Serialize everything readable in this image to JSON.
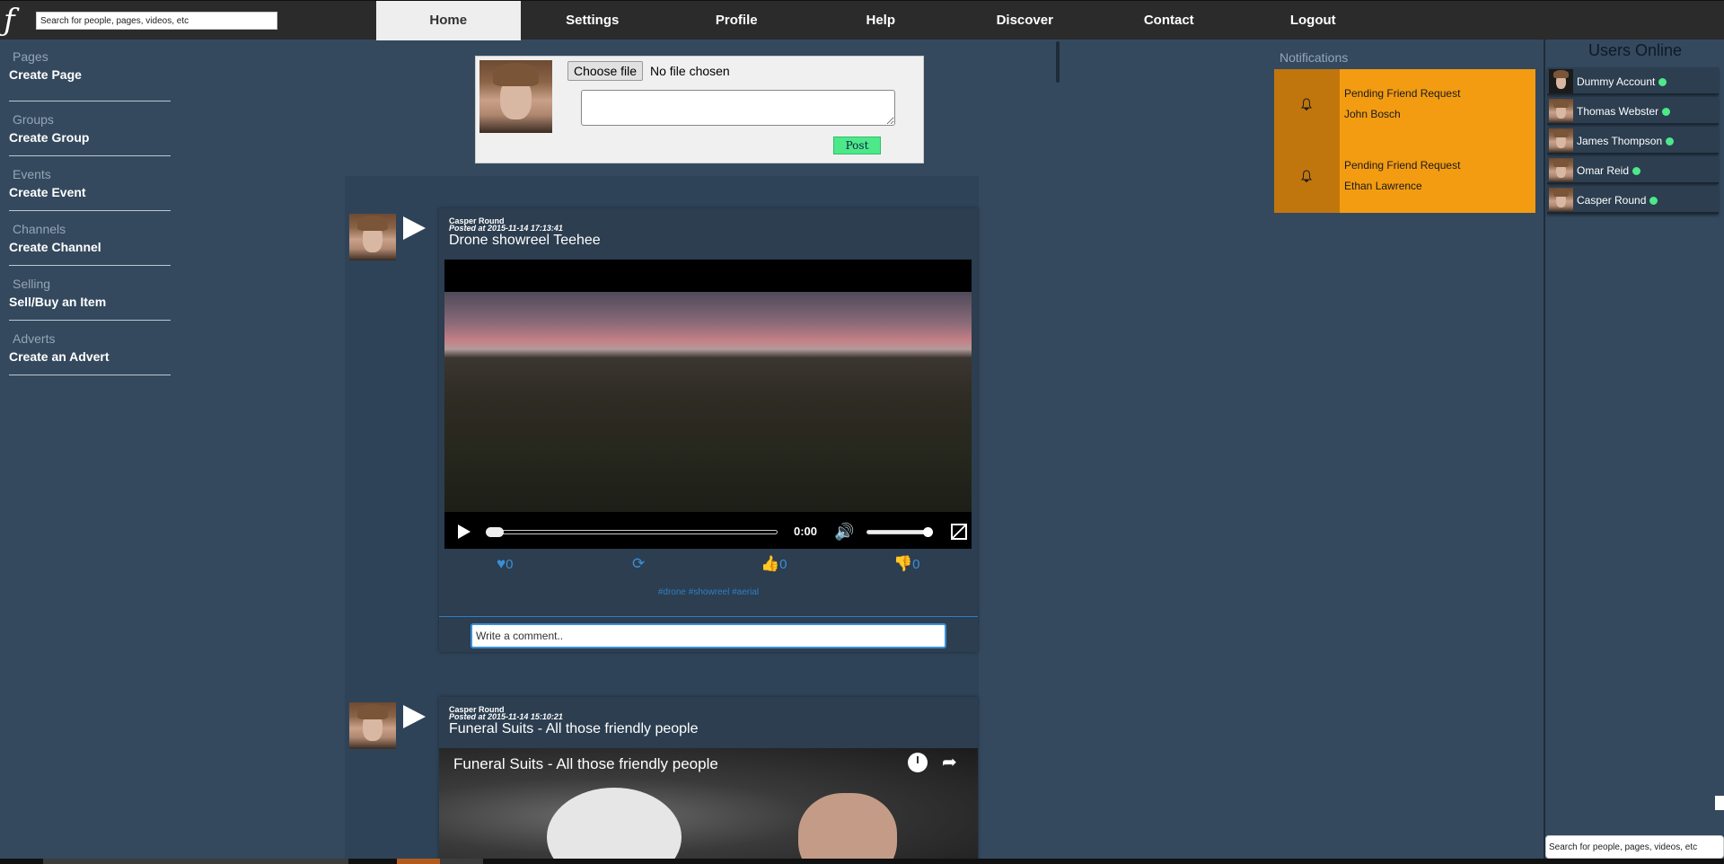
{
  "topbar": {
    "logo": "ƒ",
    "search_placeholder": "Search for people, pages, videos, etc",
    "nav": [
      {
        "label": "Home",
        "active": true
      },
      {
        "label": "Settings"
      },
      {
        "label": "Profile"
      },
      {
        "label": "Help"
      },
      {
        "label": "Discover"
      },
      {
        "label": "Contact"
      },
      {
        "label": "Logout"
      }
    ]
  },
  "sidebar": {
    "groups": [
      {
        "category": "Pages",
        "link": "Create Page"
      },
      {
        "category": "Groups",
        "link": "Create Group"
      },
      {
        "category": "Events",
        "link": "Create Event"
      },
      {
        "category": "Channels",
        "link": "Create Channel"
      },
      {
        "category": "Selling",
        "link": "Sell/Buy an Item"
      },
      {
        "category": "Adverts",
        "link": "Create an Advert"
      }
    ]
  },
  "composer": {
    "choose_file_label": "Choose file",
    "no_file_text": "No file chosen",
    "post_label": "Post"
  },
  "posts": [
    {
      "author": "Casper Round",
      "posted": "Posted at 2015-11-14 17:13:41",
      "title": "Drone showreel Teehee",
      "video_time": "0:00",
      "likes": "0",
      "shares": "",
      "thumbs_up": "0",
      "thumbs_down": "0",
      "tags": "#drone #showreel #aerial",
      "comment_placeholder": "Write a comment.."
    },
    {
      "author": "Casper Round",
      "posted": "Posted at 2015-11-14 15:10:21",
      "title": "Funeral Suits - All those friendly people",
      "embed_title": "Funeral Suits - All those friendly people"
    }
  ],
  "notifications": {
    "heading": "Notifications",
    "items": [
      {
        "type": "Pending Friend Request",
        "name": "John Bosch"
      },
      {
        "type": "Pending Friend Request",
        "name": "Ethan Lawrence"
      }
    ]
  },
  "users_online": {
    "title": "Users Online",
    "users": [
      {
        "name": "Dummy Account",
        "online": true
      },
      {
        "name": "Thomas Webster",
        "online": true
      },
      {
        "name": "James Thompson",
        "online": true
      },
      {
        "name": "Omar Reid",
        "online": true
      },
      {
        "name": "Casper Round",
        "online": true
      }
    ],
    "search_placeholder": "Search for people, pages, videos, etc"
  },
  "colors": {
    "background": "#34495e",
    "topbar": "#2b2b2b",
    "notification_bg": "#f39c12",
    "notification_icon_bg": "#c0760d",
    "post_button": "#4de88a",
    "online_dot": "#4de88a",
    "action_blue": "#3a8fd6"
  },
  "icons": {
    "logo": "ts-logo",
    "play": "play-icon",
    "heart": "heart-icon",
    "share": "refresh-icon",
    "thumbs_up": "thumbs-up-icon",
    "thumbs_down": "thumbs-down-icon",
    "bell": "bell-icon",
    "volume": "volume-icon",
    "fullscreen": "fullscreen-icon",
    "clock": "watch-later-icon",
    "share_arrow": "share-icon"
  }
}
